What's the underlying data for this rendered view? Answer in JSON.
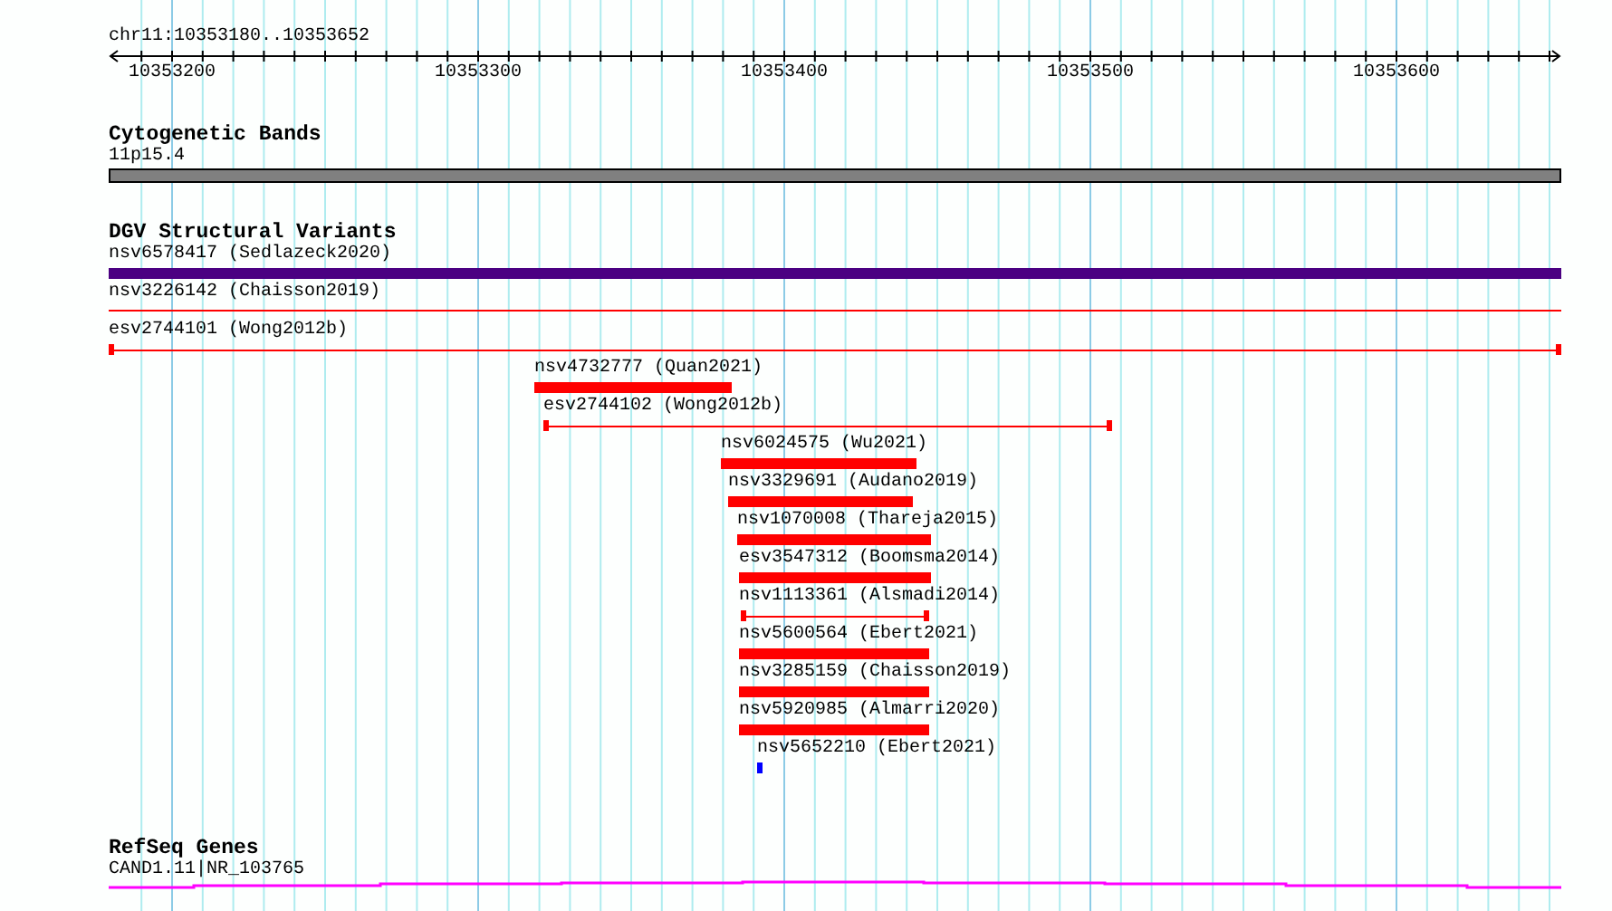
{
  "ruler": {
    "location": "chr11:10353180..10353652",
    "tick_labels": [
      "10353200",
      "10353300",
      "10353400",
      "10353500",
      "10353600"
    ]
  },
  "cytogenetic_bands": {
    "title": "Cytogenetic Bands",
    "band_label": "11p15.4"
  },
  "dgv_structural_variants": {
    "title": "DGV Structural Variants",
    "features": [
      {
        "label": "nsv6578417 (Sedlazeck2020)",
        "kind": "box",
        "color": "#4b0082"
      },
      {
        "label": "nsv3226142 (Chaisson2019)",
        "kind": "line",
        "color": "#ff0000"
      },
      {
        "label": "esv2744101 (Wong2012b)",
        "kind": "capped",
        "color": "#ff0000"
      },
      {
        "label": "nsv4732777 (Quan2021)",
        "kind": "box",
        "color": "#ff0000"
      },
      {
        "label": "esv2744102 (Wong2012b)",
        "kind": "capped",
        "color": "#ff0000"
      },
      {
        "label": "nsv6024575 (Wu2021)",
        "kind": "box",
        "color": "#ff0000"
      },
      {
        "label": "nsv3329691 (Audano2019)",
        "kind": "box",
        "color": "#ff0000"
      },
      {
        "label": "nsv1070008 (Thareja2015)",
        "kind": "box",
        "color": "#ff0000"
      },
      {
        "label": "esv3547312 (Boomsma2014)",
        "kind": "box",
        "color": "#ff0000"
      },
      {
        "label": "nsv1113361 (Alsmadi2014)",
        "kind": "capped",
        "color": "#ff0000"
      },
      {
        "label": "nsv5600564 (Ebert2021)",
        "kind": "box",
        "color": "#ff0000"
      },
      {
        "label": "nsv3285159 (Chaisson2019)",
        "kind": "box",
        "color": "#ff0000"
      },
      {
        "label": "nsv5920985 (Almarri2020)",
        "kind": "box",
        "color": "#ff0000"
      },
      {
        "label": "nsv5652210 (Ebert2021)",
        "kind": "box",
        "color": "#0000ff"
      }
    ]
  },
  "refseq_genes": {
    "title": "RefSeq Genes",
    "gene_label": "CAND1.11|NR_103765"
  }
}
